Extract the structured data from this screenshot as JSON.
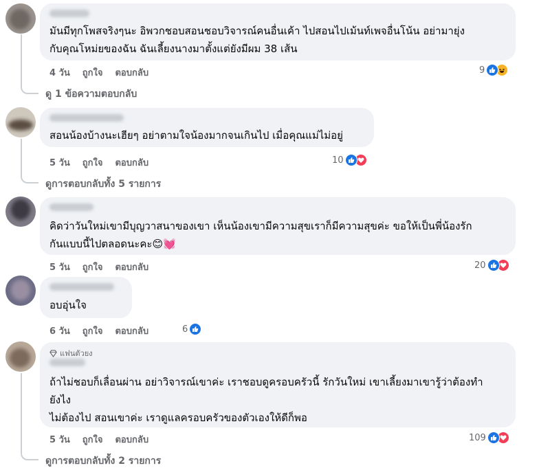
{
  "comments": [
    {
      "lines": [
        "มันมีทุกโพสจริงๆนะ อิพวกชอบสอนชอบวิจารณ์คนอื่นเค้า ไปสอนไปเม้นท์เพจอื่นโน้น อย่ามายุ่ง",
        "กับคุณโหม่ยของฉัน ฉันเลี้ยงนางมาตั้งแต่ยังมีผม 38 เส้น"
      ],
      "time": "4 วัน",
      "like_label": "ถูกใจ",
      "reply_label": "ตอบกลับ",
      "reaction_count": "9",
      "reactions": [
        "like-icon",
        "haha-icon"
      ],
      "more_replies": "ดู 1 ข้อความตอบกลับ"
    },
    {
      "lines": [
        "สอนน้องบ้างนะเฮียๆ อย่าตามใจน้องมากจนเกินไป เมื่อคุณแม่ไม่อยู่"
      ],
      "time": "5 วัน",
      "like_label": "ถูกใจ",
      "reply_label": "ตอบกลับ",
      "reaction_count": "10",
      "reactions": [
        "like-icon",
        "love-icon"
      ],
      "more_replies": "ดูการตอบกลับทั้ง 5 รายการ"
    },
    {
      "lines": [
        "คิดว่าวันใหม่เขามีบุญวาสนาของเขา เห็นน้องเขามีความสุขเราก็มีความสุขค่ะ ขอให้เป็นพี่น้องรัก",
        "กันแบบนี้ไปตลอดนะคะ😊💓"
      ],
      "time": "5 วัน",
      "like_label": "ถูกใจ",
      "reply_label": "ตอบกลับ",
      "reaction_count": "20",
      "reactions": [
        "like-icon",
        "love-icon"
      ]
    },
    {
      "lines": [
        "อบอุ่นใจ"
      ],
      "time": "6 วัน",
      "like_label": "ถูกใจ",
      "reply_label": "ตอบกลับ",
      "reaction_count": "6",
      "reactions": [
        "like-icon"
      ]
    },
    {
      "badge": "แฟนตัวยง",
      "lines": [
        "ถ้าไม่ชอบก็เลื่อนผ่าน อย่าวิจารณ์เขาค่ะ เราชอบดูครอบครัวนี้ รักวันใหม่ เขาเลี้ยงมาเขารู้ว่าต้องทำ",
        "ยังไง",
        "ไม่ต้องไป สอนเขาค่ะ เราดูแลครอบครัวของตัวเองให้ดีก็พอ"
      ],
      "time": "5 วัน",
      "like_label": "ถูกใจ",
      "reply_label": "ตอบกลับ",
      "reaction_count": "109",
      "reactions": [
        "like-icon",
        "love-icon"
      ],
      "more_replies": "ดูการตอบกลับทั้ง 2 รายการ"
    }
  ]
}
